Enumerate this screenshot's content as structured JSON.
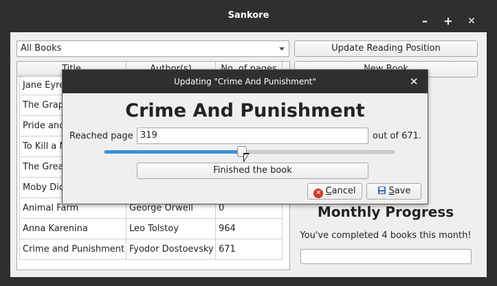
{
  "window": {
    "title": "Sankore",
    "minimize": "–",
    "maximize": "+",
    "close": "✕"
  },
  "filter": {
    "selected": "All Books"
  },
  "buttons": {
    "update_position": "Update Reading Position",
    "new_book": "New Book"
  },
  "table": {
    "headers": [
      "Title",
      "Author(s)",
      "No. of pages"
    ],
    "rows": [
      [
        "Jane Eyre",
        "",
        ""
      ],
      [
        "The Grap",
        "",
        ""
      ],
      [
        "Pride and",
        "",
        ""
      ],
      [
        "To Kill a M",
        "",
        ""
      ],
      [
        "The Grea",
        "",
        ""
      ],
      [
        "Moby Dic",
        "",
        ""
      ],
      [
        "Animal Farm",
        "George Orwell",
        "0"
      ],
      [
        "Anna Karenina",
        "Leo Tolstoy",
        "964"
      ],
      [
        "Crime and Punishment",
        "Fyodor Dostoevsky",
        "671"
      ]
    ]
  },
  "progress": {
    "title": "Monthly Progress",
    "text": "You've completed 4 books this month!",
    "fraction": 0
  },
  "dialog": {
    "title": "Updating \"Crime And Punishment\"",
    "close": "✕",
    "book_title": "Crime And Punishment",
    "reached_label": "Reached page",
    "page_value": "319",
    "out_of": "out of 671.",
    "slider_fraction": 0.4754,
    "finished_label": "Finished the book",
    "cancel_prefix": "",
    "cancel_mnemonic": "C",
    "cancel_rest": "ancel",
    "save_mnemonic": "S",
    "save_rest": "ave"
  },
  "colors": {
    "slider_fill": "#3b8fd8",
    "titlebar": "#2f2f2f",
    "cancel_icon": "#d03a2a"
  },
  "icons": {
    "cancel": "cancel-icon",
    "save": "save-icon",
    "dropdown": "chevron-down-icon"
  }
}
